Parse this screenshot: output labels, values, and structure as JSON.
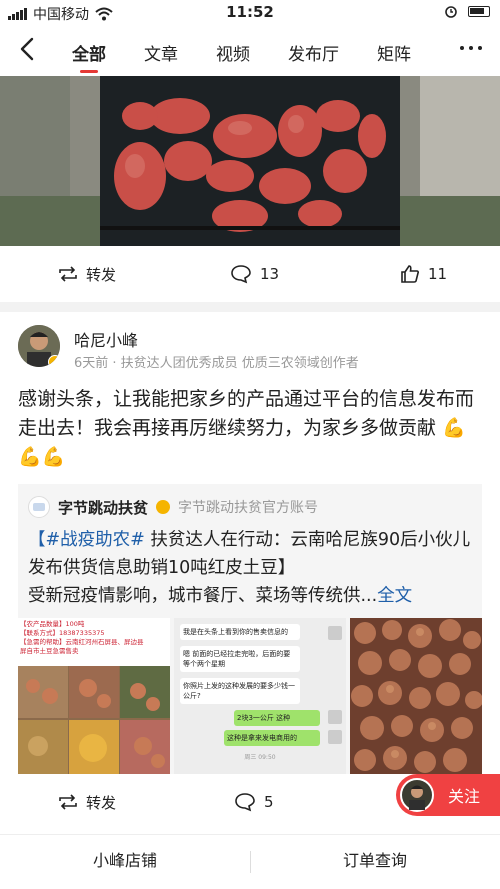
{
  "status_bar": {
    "carrier": "中国移动",
    "time": "11:52"
  },
  "nav": {
    "tabs": [
      "全部",
      "文章",
      "视频",
      "发布厅",
      "矩阵"
    ],
    "active_tab": 0
  },
  "top_actions": {
    "share_label": "转发",
    "comment_count": "13",
    "like_count": "11"
  },
  "post": {
    "author_name": "哈尼小峰",
    "meta": "6天前 · 扶贫达人团优秀成员 优质三农领域创作者",
    "text": "感谢头条，让我能把家乡的产品通过平台的信息发布而走出去！我会再接再厉继续努力，为家乡多做贡献",
    "emojis": "💪💪💪"
  },
  "quote": {
    "source_name": "字节跳动扶贫",
    "source_desc": "字节跳动扶贫官方账号",
    "hashtag": "【#战疫助农#",
    "title_rest": " 扶贫达人在行动：云南哈尼族90后小伙儿发布供货信息助销10吨红皮土豆】",
    "snippet": "受新冠疫情影响，城市餐厅、菜场等传统供...",
    "full_text_link": "全文",
    "img1_lines": [
      "【农产品数量】100吨",
      "【联系方式】18387335375",
      "【急需的帮助】云南红河州石屏县、屏边县",
      "屏自市土豆急需售卖"
    ],
    "chat_msgs": [
      "我是在头条上看到你的售卖信息的",
      "嗯 前面的已经拉走完啦，后面的要等个两个星期",
      "你照片上发的这种发展的要多少钱一公斤?",
      "2块3一公斤 这种",
      "这种是拿来发电商用的"
    ],
    "chat_time": "周三 09:50"
  },
  "bottom_actions": {
    "share_label": "转发",
    "comment_count": "5"
  },
  "follow_label": "关注",
  "bottom_bar": {
    "shop_label": "小峰店铺",
    "orders_label": "订单查询"
  },
  "colors": {
    "accent": "#f04142",
    "link": "#1f5fa9",
    "muted": "#999999"
  }
}
